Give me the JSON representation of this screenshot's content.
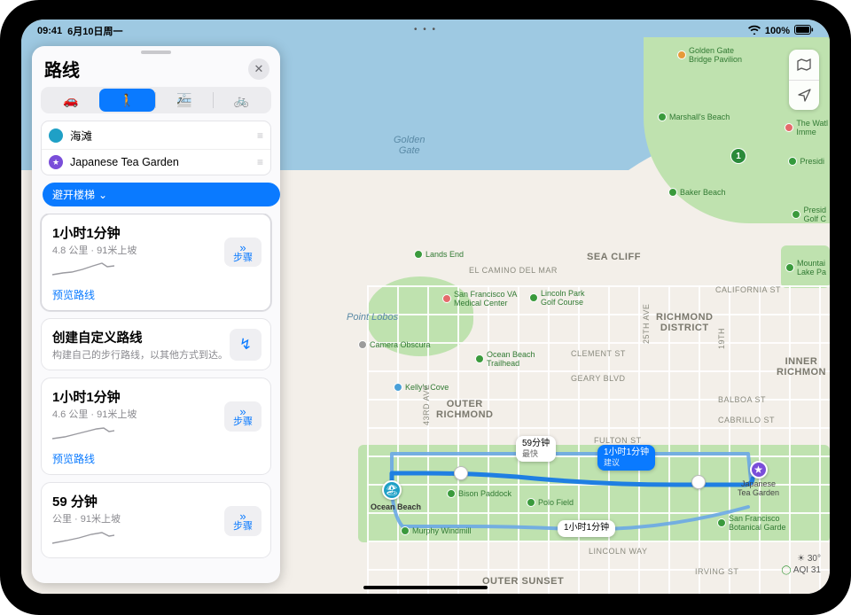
{
  "status": {
    "time": "09:41",
    "date": "6月10日周一",
    "battery": "100%"
  },
  "panel": {
    "title": "路线",
    "modes": {
      "car": "🚗",
      "walk": "🚶",
      "transit": "🚈",
      "bike": "🚲"
    },
    "from": "海滩",
    "to": "Japanese Tea Garden",
    "filter": "避开楼梯",
    "routes": [
      {
        "time": "1小时1分钟",
        "detail": "4.8 公里 · 91米上坡",
        "preview": "预览路线",
        "steps": "步骤"
      },
      {
        "time": "1小时1分钟",
        "detail": "4.6 公里 · 91米上坡",
        "preview": "预览路线",
        "steps": "步骤"
      },
      {
        "time": "59 分钟",
        "detail": "公里 · 91米上坡",
        "preview": "",
        "steps": "步骤"
      }
    ],
    "custom": {
      "title": "创建自定义路线",
      "sub": "构建自己的步行路线，以其他方式到达。"
    }
  },
  "map": {
    "water_labels": {
      "golden_gate": "Golden\nGate"
    },
    "poi": {
      "ggb": "Golden Gate\nBridge Pavilion",
      "marshall": "Marshall's Beach",
      "presidio": "Presidi",
      "watl": "The Watl\nImme",
      "baker": "Baker Beach",
      "pgolf": "Presid\nGolf C",
      "lands_end": "Lands End",
      "camino": "EL CAMINO DEL MAR",
      "sfva": "San Francisco VA\nMedical Center",
      "lincoln_golf": "Lincoln Park\nGolf Course",
      "pt_lobos": "Point Lobos",
      "camera": "Camera Obscura",
      "kellys": "Kelly's Cove",
      "ocean_tr": "Ocean Beach\nTrailhead",
      "mtn_lake": "Mountai\nLake Pa",
      "ocean_beach": "Ocean Beach",
      "bison": "Bison Paddock",
      "polo": "Polo Field",
      "murphy": "Murphy Windmill",
      "dest": "Japanese\nTea Garden",
      "sfbg": "San Francisco\nBotanical Garde"
    },
    "districts": {
      "sea_cliff": "SEA CLIFF",
      "richmond": "RICHMOND\nDISTRICT",
      "outer_richmond": "OUTER\nRICHMOND",
      "inner_richmond": "INNER\nRICHMON",
      "outer_sunset": "OUTER SUNSET"
    },
    "streets": {
      "california": "CALIFORNIA ST",
      "clement": "CLEMENT ST",
      "geary": "GEARY BLVD",
      "balboa": "BALBOA ST",
      "cabrillo": "CABRILLO ST",
      "fulton": "FULTON ST",
      "lincoln": "LINCOLN WAY",
      "irving": "IRVING ST",
      "a43": "43RD AVE",
      "a25": "25TH AVE",
      "a19": "19TH"
    },
    "badges": {
      "fastest": {
        "t": "59分钟",
        "s": "最快"
      },
      "suggested": {
        "t": "1小时1分钟",
        "s": "建议"
      },
      "alt": {
        "t": "1小时1分钟"
      }
    },
    "weather": {
      "temp": "30°",
      "aqi": "AQI 31"
    },
    "shield1": "1"
  }
}
